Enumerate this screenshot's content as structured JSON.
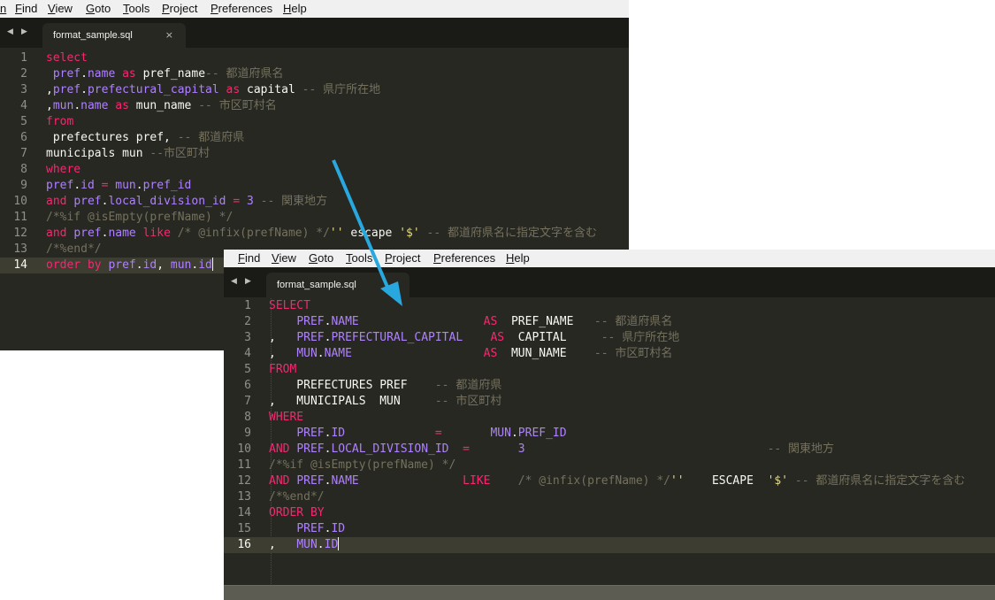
{
  "menu": [
    "Find",
    "View",
    "Goto",
    "Tools",
    "Project",
    "Preferences",
    "Help"
  ],
  "menu_cut_letter": "n",
  "tab": {
    "filename": "format_sample.sql",
    "close": "×",
    "nav_back": "◀",
    "nav_forward": "▶"
  },
  "arrow_color": "#29a8e0",
  "before": {
    "lines": [
      [
        [
          "kw",
          "select"
        ]
      ],
      [
        [
          "tx",
          " "
        ],
        [
          "id",
          "pref"
        ],
        [
          "tx",
          "."
        ],
        [
          "id",
          "name"
        ],
        [
          "tx",
          " "
        ],
        [
          "kw",
          "as"
        ],
        [
          "tx",
          " pref_name"
        ],
        [
          "cm",
          "-- 都道府県名"
        ]
      ],
      [
        [
          "tx",
          ","
        ],
        [
          "id",
          "pref"
        ],
        [
          "tx",
          "."
        ],
        [
          "id",
          "prefectural_capital"
        ],
        [
          "tx",
          " "
        ],
        [
          "kw",
          "as"
        ],
        [
          "tx",
          " capital "
        ],
        [
          "cm",
          "-- 県庁所在地"
        ]
      ],
      [
        [
          "tx",
          ","
        ],
        [
          "id",
          "mun"
        ],
        [
          "tx",
          "."
        ],
        [
          "id",
          "name"
        ],
        [
          "tx",
          " "
        ],
        [
          "kw",
          "as"
        ],
        [
          "tx",
          " mun_name "
        ],
        [
          "cm",
          "-- 市区町村名"
        ]
      ],
      [
        [
          "kw",
          "from"
        ]
      ],
      [
        [
          "tx",
          " prefectures pref, "
        ],
        [
          "cm",
          "-- 都道府県"
        ]
      ],
      [
        [
          "tx",
          "municipals mun "
        ],
        [
          "cm",
          "--市区町村"
        ]
      ],
      [
        [
          "kw",
          "where"
        ]
      ],
      [
        [
          "id",
          "pref"
        ],
        [
          "tx",
          "."
        ],
        [
          "id",
          "id"
        ],
        [
          "tx",
          " "
        ],
        [
          "kw",
          "="
        ],
        [
          "tx",
          " "
        ],
        [
          "id",
          "mun"
        ],
        [
          "tx",
          "."
        ],
        [
          "id",
          "pref_id"
        ]
      ],
      [
        [
          "kw",
          "and"
        ],
        [
          "tx",
          " "
        ],
        [
          "id",
          "pref"
        ],
        [
          "tx",
          "."
        ],
        [
          "id",
          "local_division_id"
        ],
        [
          "tx",
          " "
        ],
        [
          "kw",
          "="
        ],
        [
          "tx",
          " "
        ],
        [
          "id",
          "3"
        ],
        [
          "tx",
          " "
        ],
        [
          "cm",
          "-- 関東地方"
        ]
      ],
      [
        [
          "cm",
          "/*%if @isEmpty(prefName) */"
        ]
      ],
      [
        [
          "kw",
          "and"
        ],
        [
          "tx",
          " "
        ],
        [
          "id",
          "pref"
        ],
        [
          "tx",
          "."
        ],
        [
          "id",
          "name"
        ],
        [
          "tx",
          " "
        ],
        [
          "kw",
          "like"
        ],
        [
          "tx",
          " "
        ],
        [
          "cm",
          "/* @infix(prefName) */"
        ],
        [
          "st",
          "''"
        ],
        [
          "tx",
          " escape "
        ],
        [
          "st",
          "'$'"
        ],
        [
          "tx",
          " "
        ],
        [
          "cm",
          "-- 都道府県名に指定文字を含む"
        ]
      ],
      [
        [
          "cm",
          "/*%end*/"
        ]
      ],
      [
        [
          "kw",
          "order by"
        ],
        [
          "tx",
          " "
        ],
        [
          "id",
          "pref"
        ],
        [
          "tx",
          "."
        ],
        [
          "id",
          "id"
        ],
        [
          "tx",
          ", "
        ],
        [
          "id",
          "mun"
        ],
        [
          "tx",
          "."
        ],
        [
          "id",
          "id"
        ]
      ]
    ]
  },
  "after": {
    "lines": [
      [
        [
          "kw",
          "SELECT"
        ]
      ],
      [
        [
          "tx",
          "    "
        ],
        [
          "id",
          "PREF"
        ],
        [
          "tx",
          "."
        ],
        [
          "id",
          "NAME"
        ],
        [
          "tx",
          "                  "
        ],
        [
          "kw",
          "AS"
        ],
        [
          "tx",
          "  PREF_NAME   "
        ],
        [
          "cm",
          "-- 都道府県名"
        ]
      ],
      [
        [
          "tx",
          ",   "
        ],
        [
          "id",
          "PREF"
        ],
        [
          "tx",
          "."
        ],
        [
          "id",
          "PREFECTURAL_CAPITAL"
        ],
        [
          "tx",
          "    "
        ],
        [
          "kw",
          "AS"
        ],
        [
          "tx",
          "  CAPITAL     "
        ],
        [
          "cm",
          "-- 県庁所在地"
        ]
      ],
      [
        [
          "tx",
          ",   "
        ],
        [
          "id",
          "MUN"
        ],
        [
          "tx",
          "."
        ],
        [
          "id",
          "NAME"
        ],
        [
          "tx",
          "                   "
        ],
        [
          "kw",
          "AS"
        ],
        [
          "tx",
          "  MUN_NAME    "
        ],
        [
          "cm",
          "-- 市区町村名"
        ]
      ],
      [
        [
          "kw",
          "FROM"
        ]
      ],
      [
        [
          "tx",
          "    PREFECTURES PREF    "
        ],
        [
          "cm",
          "-- 都道府県"
        ]
      ],
      [
        [
          "tx",
          ",   MUNICIPALS  MUN     "
        ],
        [
          "cm",
          "-- 市区町村"
        ]
      ],
      [
        [
          "kw",
          "WHERE"
        ]
      ],
      [
        [
          "tx",
          "    "
        ],
        [
          "id",
          "PREF"
        ],
        [
          "tx",
          "."
        ],
        [
          "id",
          "ID"
        ],
        [
          "tx",
          "             "
        ],
        [
          "kw",
          "="
        ],
        [
          "tx",
          "       "
        ],
        [
          "id",
          "MUN"
        ],
        [
          "tx",
          "."
        ],
        [
          "id",
          "PREF_ID"
        ]
      ],
      [
        [
          "kw",
          "AND"
        ],
        [
          "tx",
          " "
        ],
        [
          "id",
          "PREF"
        ],
        [
          "tx",
          "."
        ],
        [
          "id",
          "LOCAL_DIVISION_ID"
        ],
        [
          "tx",
          "  "
        ],
        [
          "kw",
          "="
        ],
        [
          "tx",
          "       "
        ],
        [
          "id",
          "3"
        ],
        [
          "tx",
          "                                   "
        ],
        [
          "cm",
          "-- 関東地方"
        ]
      ],
      [
        [
          "cm",
          "/*%if @isEmpty(prefName) */"
        ]
      ],
      [
        [
          "kw",
          "AND"
        ],
        [
          "tx",
          " "
        ],
        [
          "id",
          "PREF"
        ],
        [
          "tx",
          "."
        ],
        [
          "id",
          "NAME"
        ],
        [
          "tx",
          "               "
        ],
        [
          "kw",
          "LIKE"
        ],
        [
          "tx",
          "    "
        ],
        [
          "cm",
          "/* @infix(prefName) */"
        ],
        [
          "st",
          "''"
        ],
        [
          "tx",
          "    ESCAPE  "
        ],
        [
          "st",
          "'$'"
        ],
        [
          "tx",
          " "
        ],
        [
          "cm",
          "-- 都道府県名に指定文字を含む"
        ]
      ],
      [
        [
          "cm",
          "/*%end*/"
        ]
      ],
      [
        [
          "kw",
          "ORDER BY"
        ]
      ],
      [
        [
          "tx",
          "    "
        ],
        [
          "id",
          "PREF"
        ],
        [
          "tx",
          "."
        ],
        [
          "id",
          "ID"
        ]
      ],
      [
        [
          "tx",
          ",   "
        ],
        [
          "id",
          "MUN"
        ],
        [
          "tx",
          "."
        ],
        [
          "id",
          "ID"
        ]
      ]
    ]
  }
}
